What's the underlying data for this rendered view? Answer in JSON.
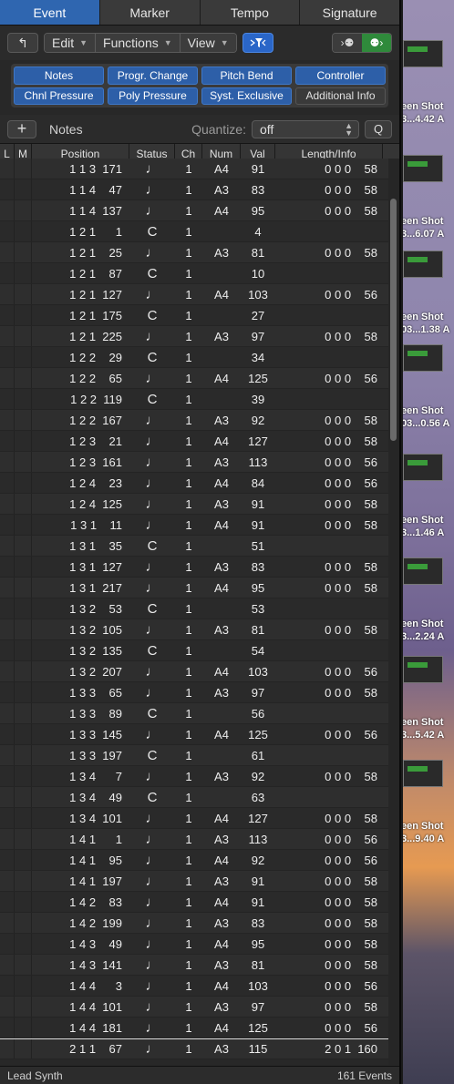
{
  "tabs": [
    "Event",
    "Marker",
    "Tempo",
    "Signature"
  ],
  "toolbar": {
    "up_icon": "arrow-up-icon",
    "edit": "Edit",
    "functions": "Functions",
    "view": "View",
    "filter_icon": "filter-icon",
    "midi_in": "MIDI in",
    "midi_out": "MIDI out"
  },
  "filters": [
    {
      "label": "Notes",
      "on": true
    },
    {
      "label": "Progr. Change",
      "on": true
    },
    {
      "label": "Pitch Bend",
      "on": true
    },
    {
      "label": "Controller",
      "on": true
    },
    {
      "label": "Chnl Pressure",
      "on": true
    },
    {
      "label": "Poly Pressure",
      "on": true
    },
    {
      "label": "Syst. Exclusive",
      "on": true
    },
    {
      "label": "Additional Info",
      "on": false
    }
  ],
  "create": {
    "plus": "+",
    "type": "Notes",
    "quantize_label": "Quantize:",
    "quantize_value": "off",
    "q_button": "Q"
  },
  "columns": {
    "l": "L",
    "m": "M",
    "position": "Position",
    "status": "Status",
    "ch": "Ch",
    "num": "Num",
    "val": "Val",
    "length": "Length/Info"
  },
  "rows": [
    {
      "pos": "1 1 3  171",
      "st": "note",
      "ch": "1",
      "num": "A4",
      "val": "91",
      "len": "0 0 0    58"
    },
    {
      "pos": "1 1 4    47",
      "st": "note",
      "ch": "1",
      "num": "A3",
      "val": "83",
      "len": "0 0 0    58"
    },
    {
      "pos": "1 1 4  137",
      "st": "note",
      "ch": "1",
      "num": "A4",
      "val": "95",
      "len": "0 0 0    58"
    },
    {
      "pos": "1 2 1      1",
      "st": "C",
      "ch": "1",
      "num": "",
      "val": "4",
      "len": ""
    },
    {
      "pos": "1 2 1    25",
      "st": "note",
      "ch": "1",
      "num": "A3",
      "val": "81",
      "len": "0 0 0    58"
    },
    {
      "pos": "1 2 1    87",
      "st": "C",
      "ch": "1",
      "num": "",
      "val": "10",
      "len": ""
    },
    {
      "pos": "1 2 1  127",
      "st": "note",
      "ch": "1",
      "num": "A4",
      "val": "103",
      "len": "0 0 0    56"
    },
    {
      "pos": "1 2 1  175",
      "st": "C",
      "ch": "1",
      "num": "",
      "val": "27",
      "len": ""
    },
    {
      "pos": "1 2 1  225",
      "st": "note",
      "ch": "1",
      "num": "A3",
      "val": "97",
      "len": "0 0 0    58"
    },
    {
      "pos": "1 2 2    29",
      "st": "C",
      "ch": "1",
      "num": "",
      "val": "34",
      "len": ""
    },
    {
      "pos": "1 2 2    65",
      "st": "note",
      "ch": "1",
      "num": "A4",
      "val": "125",
      "len": "0 0 0    56"
    },
    {
      "pos": "1 2 2  119",
      "st": "C",
      "ch": "1",
      "num": "",
      "val": "39",
      "len": ""
    },
    {
      "pos": "1 2 2  167",
      "st": "note",
      "ch": "1",
      "num": "A3",
      "val": "92",
      "len": "0 0 0    58"
    },
    {
      "pos": "1 2 3    21",
      "st": "note",
      "ch": "1",
      "num": "A4",
      "val": "127",
      "len": "0 0 0    58"
    },
    {
      "pos": "1 2 3  161",
      "st": "note",
      "ch": "1",
      "num": "A3",
      "val": "113",
      "len": "0 0 0    56"
    },
    {
      "pos": "1 2 4    23",
      "st": "note",
      "ch": "1",
      "num": "A4",
      "val": "84",
      "len": "0 0 0    56"
    },
    {
      "pos": "1 2 4  125",
      "st": "note",
      "ch": "1",
      "num": "A3",
      "val": "91",
      "len": "0 0 0    58"
    },
    {
      "pos": "1 3 1    11",
      "st": "note",
      "ch": "1",
      "num": "A4",
      "val": "91",
      "len": "0 0 0    58"
    },
    {
      "pos": "1 3 1    35",
      "st": "C",
      "ch": "1",
      "num": "",
      "val": "51",
      "len": ""
    },
    {
      "pos": "1 3 1  127",
      "st": "note",
      "ch": "1",
      "num": "A3",
      "val": "83",
      "len": "0 0 0    58"
    },
    {
      "pos": "1 3 1  217",
      "st": "note",
      "ch": "1",
      "num": "A4",
      "val": "95",
      "len": "0 0 0    58"
    },
    {
      "pos": "1 3 2    53",
      "st": "C",
      "ch": "1",
      "num": "",
      "val": "53",
      "len": ""
    },
    {
      "pos": "1 3 2  105",
      "st": "note",
      "ch": "1",
      "num": "A3",
      "val": "81",
      "len": "0 0 0    58"
    },
    {
      "pos": "1 3 2  135",
      "st": "C",
      "ch": "1",
      "num": "",
      "val": "54",
      "len": ""
    },
    {
      "pos": "1 3 2  207",
      "st": "note",
      "ch": "1",
      "num": "A4",
      "val": "103",
      "len": "0 0 0    56"
    },
    {
      "pos": "1 3 3    65",
      "st": "note",
      "ch": "1",
      "num": "A3",
      "val": "97",
      "len": "0 0 0    58"
    },
    {
      "pos": "1 3 3    89",
      "st": "C",
      "ch": "1",
      "num": "",
      "val": "56",
      "len": ""
    },
    {
      "pos": "1 3 3  145",
      "st": "note",
      "ch": "1",
      "num": "A4",
      "val": "125",
      "len": "0 0 0    56"
    },
    {
      "pos": "1 3 3  197",
      "st": "C",
      "ch": "1",
      "num": "",
      "val": "61",
      "len": ""
    },
    {
      "pos": "1 3 4      7",
      "st": "note",
      "ch": "1",
      "num": "A3",
      "val": "92",
      "len": "0 0 0    58"
    },
    {
      "pos": "1 3 4    49",
      "st": "C",
      "ch": "1",
      "num": "",
      "val": "63",
      "len": ""
    },
    {
      "pos": "1 3 4  101",
      "st": "note",
      "ch": "1",
      "num": "A4",
      "val": "127",
      "len": "0 0 0    58"
    },
    {
      "pos": "1 4 1      1",
      "st": "note",
      "ch": "1",
      "num": "A3",
      "val": "113",
      "len": "0 0 0    56"
    },
    {
      "pos": "1 4 1    95",
      "st": "note",
      "ch": "1",
      "num": "A4",
      "val": "92",
      "len": "0 0 0    56"
    },
    {
      "pos": "1 4 1  197",
      "st": "note",
      "ch": "1",
      "num": "A3",
      "val": "91",
      "len": "0 0 0    58"
    },
    {
      "pos": "1 4 2    83",
      "st": "note",
      "ch": "1",
      "num": "A4",
      "val": "91",
      "len": "0 0 0    58"
    },
    {
      "pos": "1 4 2  199",
      "st": "note",
      "ch": "1",
      "num": "A3",
      "val": "83",
      "len": "0 0 0    58"
    },
    {
      "pos": "1 4 3    49",
      "st": "note",
      "ch": "1",
      "num": "A4",
      "val": "95",
      "len": "0 0 0    58"
    },
    {
      "pos": "1 4 3  141",
      "st": "note",
      "ch": "1",
      "num": "A3",
      "val": "81",
      "len": "0 0 0    58"
    },
    {
      "pos": "1 4 4      3",
      "st": "note",
      "ch": "1",
      "num": "A4",
      "val": "103",
      "len": "0 0 0    56"
    },
    {
      "pos": "1 4 4  101",
      "st": "note",
      "ch": "1",
      "num": "A3",
      "val": "97",
      "len": "0 0 0    58"
    },
    {
      "pos": "1 4 4  181",
      "st": "note",
      "ch": "1",
      "num": "A4",
      "val": "125",
      "len": "0 0 0    56"
    },
    {
      "pos": "2 1 1    67",
      "st": "note",
      "ch": "1",
      "num": "A3",
      "val": "115",
      "len": "2 0 1  160"
    }
  ],
  "status": {
    "track": "Lead Synth",
    "count": "161 Events"
  },
  "desktop": {
    "labels": [
      {
        "line1": "een Shot",
        "line2": "3...4.42 A"
      },
      {
        "line1": "een Shot",
        "line2": "3...6.07 A"
      },
      {
        "line1": "een Shot",
        "line2": "03...1.38 A"
      },
      {
        "line1": "een Shot",
        "line2": "03...0.56 A"
      },
      {
        "line1": "een Shot",
        "line2": "3...1.46 A"
      },
      {
        "line1": "een Shot",
        "line2": "3...2.24 A"
      },
      {
        "line1": "een Shot",
        "line2": "3...5.42 A"
      },
      {
        "line1": "een Shot",
        "line2": "3...9.40 A"
      }
    ]
  }
}
